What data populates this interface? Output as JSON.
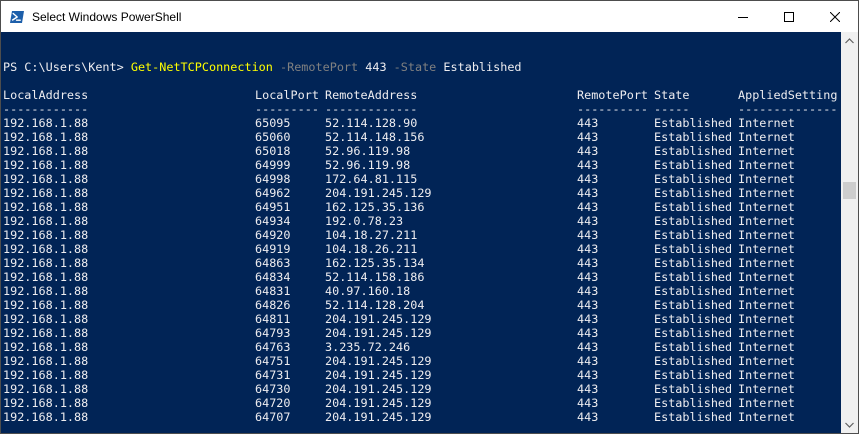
{
  "window": {
    "title": "Select Windows PowerShell"
  },
  "command": {
    "prompt": "PS C:\\Users\\Kent> ",
    "name": "Get-NetTCPConnection",
    "param1": "-RemotePort",
    "arg1": "443",
    "param2": "-State",
    "arg2": "Established"
  },
  "table": {
    "headers": [
      "LocalAddress",
      "LocalPort",
      "RemoteAddress",
      "RemotePort",
      "State",
      "AppliedSetting"
    ],
    "underlines": [
      "------------",
      "---------",
      "-------------",
      "----------",
      "-----",
      "--------------"
    ],
    "rows": [
      [
        "192.168.1.88",
        "65095",
        "52.114.128.90",
        "443",
        "Established",
        "Internet"
      ],
      [
        "192.168.1.88",
        "65060",
        "52.114.148.156",
        "443",
        "Established",
        "Internet"
      ],
      [
        "192.168.1.88",
        "65018",
        "52.96.119.98",
        "443",
        "Established",
        "Internet"
      ],
      [
        "192.168.1.88",
        "64999",
        "52.96.119.98",
        "443",
        "Established",
        "Internet"
      ],
      [
        "192.168.1.88",
        "64998",
        "172.64.81.115",
        "443",
        "Established",
        "Internet"
      ],
      [
        "192.168.1.88",
        "64962",
        "204.191.245.129",
        "443",
        "Established",
        "Internet"
      ],
      [
        "192.168.1.88",
        "64951",
        "162.125.35.136",
        "443",
        "Established",
        "Internet"
      ],
      [
        "192.168.1.88",
        "64934",
        "192.0.78.23",
        "443",
        "Established",
        "Internet"
      ],
      [
        "192.168.1.88",
        "64920",
        "104.18.27.211",
        "443",
        "Established",
        "Internet"
      ],
      [
        "192.168.1.88",
        "64919",
        "104.18.26.211",
        "443",
        "Established",
        "Internet"
      ],
      [
        "192.168.1.88",
        "64863",
        "162.125.35.134",
        "443",
        "Established",
        "Internet"
      ],
      [
        "192.168.1.88",
        "64834",
        "52.114.158.186",
        "443",
        "Established",
        "Internet"
      ],
      [
        "192.168.1.88",
        "64831",
        "40.97.160.18",
        "443",
        "Established",
        "Internet"
      ],
      [
        "192.168.1.88",
        "64826",
        "52.114.128.204",
        "443",
        "Established",
        "Internet"
      ],
      [
        "192.168.1.88",
        "64811",
        "204.191.245.129",
        "443",
        "Established",
        "Internet"
      ],
      [
        "192.168.1.88",
        "64793",
        "204.191.245.129",
        "443",
        "Established",
        "Internet"
      ],
      [
        "192.168.1.88",
        "64763",
        "3.235.72.246",
        "443",
        "Established",
        "Internet"
      ],
      [
        "192.168.1.88",
        "64751",
        "204.191.245.129",
        "443",
        "Established",
        "Internet"
      ],
      [
        "192.168.1.88",
        "64731",
        "204.191.245.129",
        "443",
        "Established",
        "Internet"
      ],
      [
        "192.168.1.88",
        "64730",
        "204.191.245.129",
        "443",
        "Established",
        "Internet"
      ],
      [
        "192.168.1.88",
        "64720",
        "204.191.245.129",
        "443",
        "Established",
        "Internet"
      ],
      [
        "192.168.1.88",
        "64707",
        "204.191.245.129",
        "443",
        "Established",
        "Internet"
      ]
    ]
  },
  "colors": {
    "background": "#012456",
    "foreground": "#eeedf0",
    "cmdlet": "#ffff00",
    "parameter": "#808080"
  },
  "icons": {
    "app": "powershell-icon",
    "minimize": "minimize-icon",
    "maximize": "maximize-icon",
    "close": "close-icon"
  }
}
